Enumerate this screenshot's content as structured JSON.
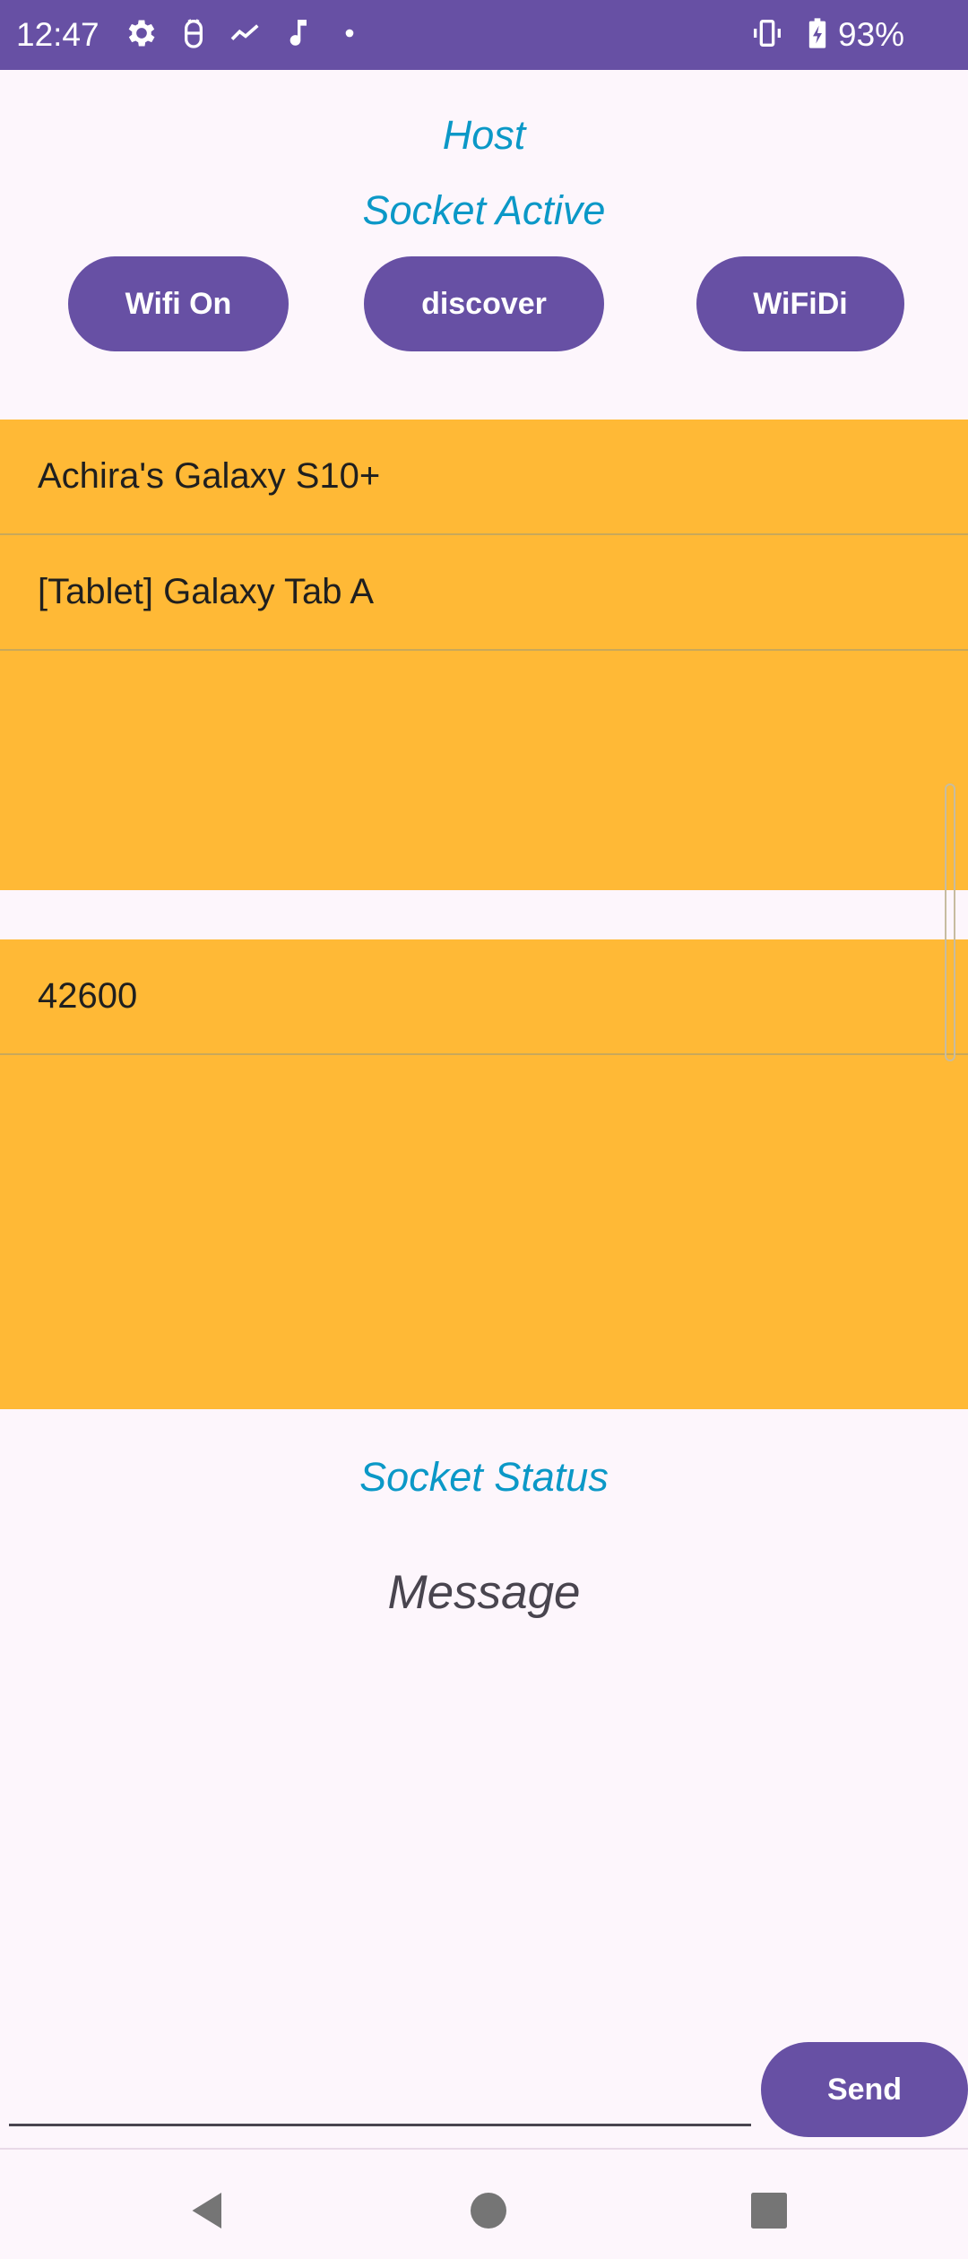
{
  "status_bar": {
    "time": "12:47",
    "battery": "93%",
    "icons": [
      "settings-icon",
      "android-debug-icon",
      "activity-trend-icon",
      "music-note-icon",
      "dot-icon",
      "vibrate-icon",
      "battery-charging-icon"
    ],
    "background": "#6750a4"
  },
  "header": {
    "role": "Host",
    "socket_state": "Socket Active"
  },
  "buttons": {
    "wifi": "Wifi On",
    "discover": "discover",
    "wifidi": "WiFiDi",
    "send": "Send"
  },
  "devices": {
    "items": [
      "Achira's Galaxy S10+",
      "[Tablet] Galaxy Tab A"
    ]
  },
  "ports": {
    "items": [
      "42600"
    ]
  },
  "socket_status_label": "Socket Status",
  "message_label": "Message",
  "message_input": {
    "value": "",
    "placeholder": ""
  },
  "nav": [
    "back-icon",
    "home-icon",
    "recents-icon"
  ],
  "colors": {
    "primary": "#6750a4",
    "accent_text": "#0b98c7",
    "list_background": "#ffb936",
    "page_background": "#fdf6fc"
  }
}
